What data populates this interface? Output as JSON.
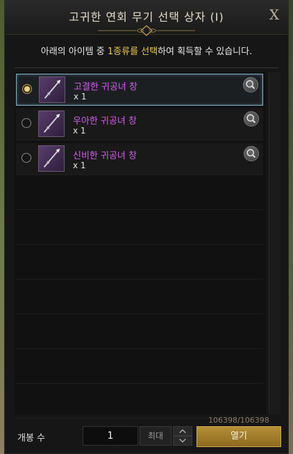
{
  "dialog": {
    "title": "고귀한 연회 무기 선택 상자 (I)",
    "close_label": "X"
  },
  "instruction": {
    "prefix": "아래의 아이템 중 ",
    "highlight": "1종류를 선택",
    "suffix": "하여 획득할 수 있습니다."
  },
  "items": [
    {
      "name": "고결한 귀공녀 창",
      "qty": "x 1",
      "selected": true
    },
    {
      "name": "우아한 귀공녀 창",
      "qty": "x 1",
      "selected": false
    },
    {
      "name": "신비한 귀공녀 창",
      "qty": "x 1",
      "selected": false
    }
  ],
  "footer": {
    "label": "개봉 수",
    "quantity": "1",
    "max_label": "최대",
    "open_label": "열기"
  },
  "background": {
    "hp_readout": "106398/106398"
  },
  "colors": {
    "item_name": "#d65cf2",
    "highlight": "#f0c64a",
    "open_button": "#b58f37",
    "selection_border": "#7fb0c8"
  }
}
